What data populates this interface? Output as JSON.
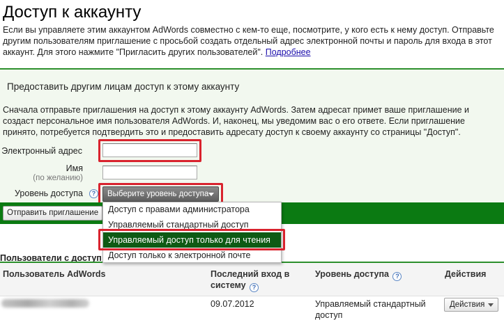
{
  "page": {
    "title": "Доступ к аккаунту",
    "intro_text": "Если вы управляете этим аккаунтом AdWords совместно с кем-то еще, посмотрите, у кого есть к нему доступ. Отправьте другим пользователям приглашение с просьбой создать отдельный адрес электронной почты и пароль для входа в этот аккаунт. Для этого нажмите \"Пригласить других пользователей\".",
    "more_link": "Подробнее"
  },
  "invite": {
    "section_title": "Предоставить другим лицам доступ к этому аккаунту",
    "instructions": "Сначала отправьте приглашения на доступ к этому аккаунту AdWords. Затем адресат примет ваше приглашение и создаст персональное имя пользователя AdWords. И, наконец, мы уведомим вас о его ответе. Если приглашение принято, потребуется подтвердить это и предоставить адресату доступ к своему аккаунту со страницы \"Доступ\".",
    "email_label": "Электронный адрес",
    "email_value": "",
    "name_label": "Имя",
    "name_sublabel": "(по желанию)",
    "name_value": "",
    "access_label": "Уровень доступа",
    "access_select": "Выберите уровень доступа",
    "send_button": "Отправить приглашение",
    "dropdown_options": [
      "Доступ с правами администратора",
      "Управляемый стандартный доступ",
      "Управляемый доступ только для чтения",
      "Доступ только к электронной почте"
    ],
    "selected_option_index": 2,
    "highlight_color": "#d9232e",
    "accent_green": "#0b7a12"
  },
  "users": {
    "heading": "Пользователи с доступ",
    "columns": {
      "user": "Пользователь AdWords",
      "last_login": "Последний вход в систему",
      "access": "Уровень доступа",
      "actions": "Действия"
    },
    "rows": [
      {
        "last_login": "09.07.2012",
        "access": "Управляемый стандартный доступ",
        "actions_button": "Действия"
      }
    ]
  }
}
